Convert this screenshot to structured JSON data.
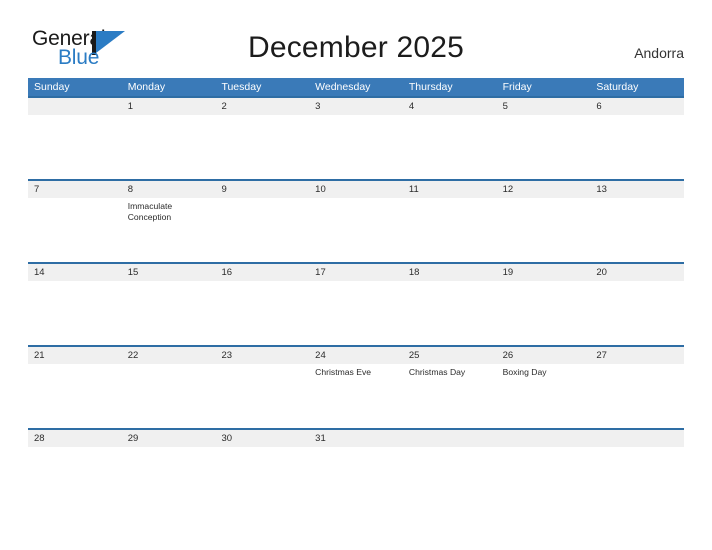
{
  "brand": {
    "name_part1": "General",
    "name_part2": "Blue",
    "flag_icon": "triangle-flag-icon"
  },
  "header": {
    "title": "December 2025",
    "country": "Andorra"
  },
  "calendar": {
    "day_headers": [
      "Sunday",
      "Monday",
      "Tuesday",
      "Wednesday",
      "Thursday",
      "Friday",
      "Saturday"
    ],
    "header_color": "#3a7ab8",
    "row_band_color": "#f0f0f0",
    "row_rule_color": "#2e6da4",
    "weeks": [
      {
        "numbers": [
          "",
          "1",
          "2",
          "3",
          "4",
          "5",
          "6"
        ],
        "events": [
          "",
          "",
          "",
          "",
          "",
          "",
          ""
        ]
      },
      {
        "numbers": [
          "7",
          "8",
          "9",
          "10",
          "11",
          "12",
          "13"
        ],
        "events": [
          "",
          "Immaculate Conception",
          "",
          "",
          "",
          "",
          ""
        ]
      },
      {
        "numbers": [
          "14",
          "15",
          "16",
          "17",
          "18",
          "19",
          "20"
        ],
        "events": [
          "",
          "",
          "",
          "",
          "",
          "",
          ""
        ]
      },
      {
        "numbers": [
          "21",
          "22",
          "23",
          "24",
          "25",
          "26",
          "27"
        ],
        "events": [
          "",
          "",
          "",
          "Christmas Eve",
          "Christmas Day",
          "Boxing Day",
          ""
        ]
      },
      {
        "numbers": [
          "28",
          "29",
          "30",
          "31",
          "",
          "",
          ""
        ],
        "events": [
          "",
          "",
          "",
          "",
          "",
          "",
          ""
        ]
      }
    ]
  }
}
